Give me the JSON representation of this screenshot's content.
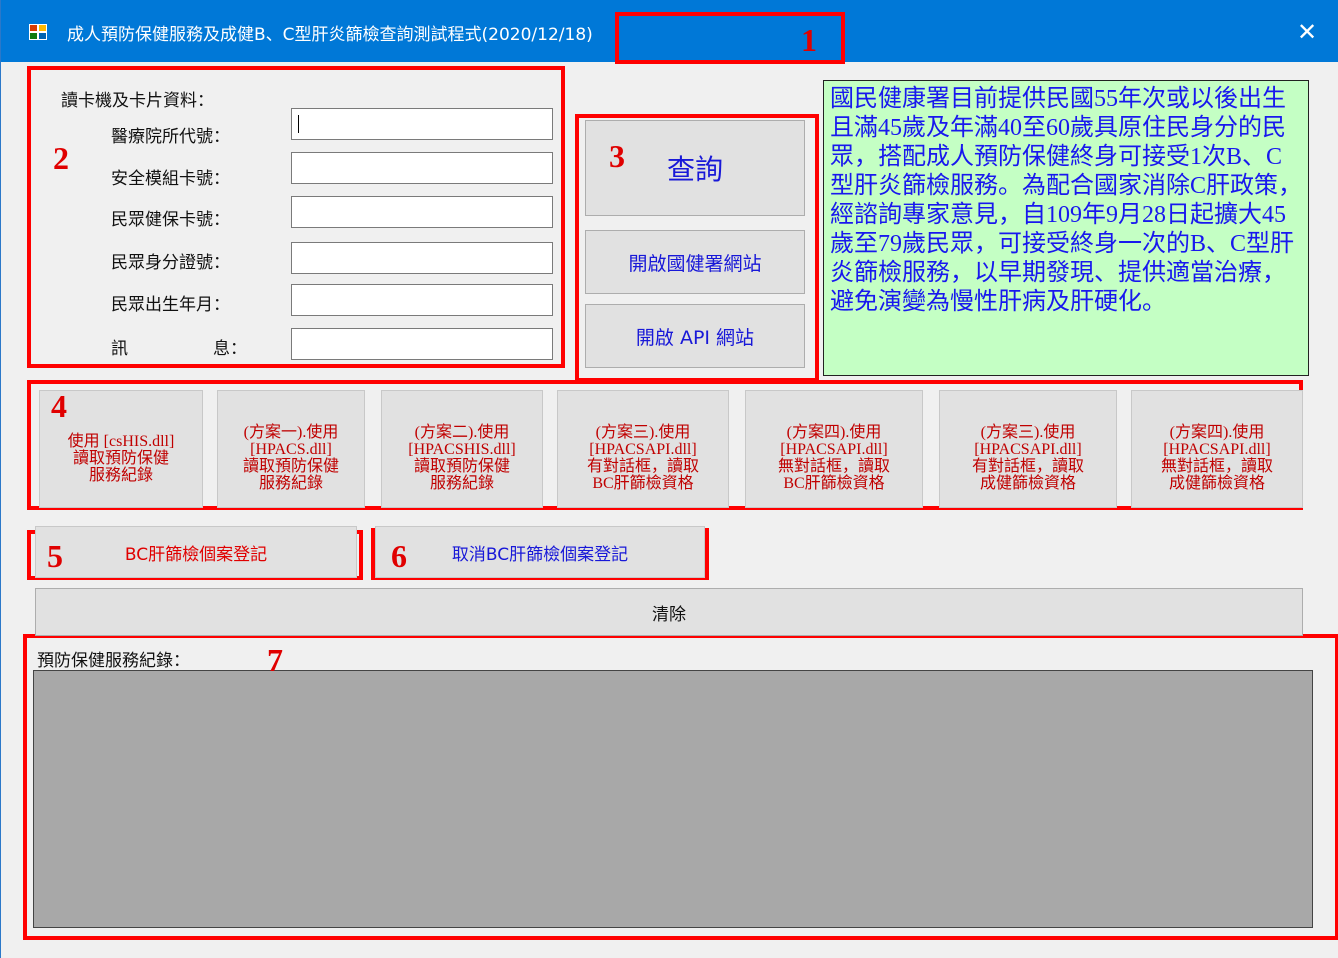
{
  "window": {
    "title": "成人預防保健服務及成健B、C型肝炎篩檢查詢測試程式(2020/12/18)",
    "close_glyph": "✕"
  },
  "markers": [
    "1",
    "2",
    "3",
    "4",
    "5",
    "6",
    "7"
  ],
  "card_section": {
    "heading": "讀卡機及卡片資料：",
    "fields": [
      {
        "label": "醫療院所代號：",
        "value": ""
      },
      {
        "label": "安全模組卡號：",
        "value": ""
      },
      {
        "label": "民眾健保卡號：",
        "value": ""
      },
      {
        "label": "民眾身分證號：",
        "value": ""
      },
      {
        "label": "民眾出生年月：",
        "value": ""
      },
      {
        "label": "訊",
        "label_b": "息：",
        "value": ""
      }
    ]
  },
  "actions": {
    "query": "查詢",
    "open_hpa": "開啟國健署網站",
    "open_api": "開啟 API 網站"
  },
  "info_text": "國民健康署目前提供民國55年次或以後出生且滿45歲及年滿40至60歲具原住民身分的民眾，搭配成人預防保健終身可接受1次B、C型肝炎篩檢服務。為配合國家消除C肝政策，經諮詢專家意見，自109年9月28日起擴大45歲至79歲民眾，可接受終身一次的B、C型肝炎篩檢服務，以早期發現、提供適當治療，避免演變為慢性肝病及肝硬化。",
  "option_buttons": [
    "使用 [csHIS.dll]\n讀取預防保健\n服務紀錄",
    "(方案一).使用\n[HPACS.dll]\n讀取預防保健\n服務紀錄",
    "(方案二).使用\n[HPACSHIS.dll]\n讀取預防保健\n服務紀錄",
    "(方案三).使用\n[HPACSAPI.dll]\n有對話框，讀取\nBC肝篩檢資格",
    "(方案四).使用\n[HPACSAPI.dll]\n無對話框，讀取\nBC肝篩檢資格",
    "(方案三).使用\n[HPACSAPI.dll]\n有對話框，讀取\n成健篩檢資格",
    "(方案四).使用\n[HPACSAPI.dll]\n無對話框，讀取\n成健篩檢資格"
  ],
  "register": {
    "register_label": "BC肝篩檢個案登記",
    "cancel_label": "取消BC肝篩檢個案登記",
    "register_color": "#e00000",
    "cancel_color": "#1818d8"
  },
  "clear_label": "清除",
  "records": {
    "heading": "預防保健服務紀錄：",
    "content": ""
  },
  "colors": {
    "titlebar": "#0078d7",
    "annotation_red": "#ff0000",
    "info_bg": "#c4ffc4",
    "info_text": "#1818ee",
    "option_text": "#c00000"
  }
}
